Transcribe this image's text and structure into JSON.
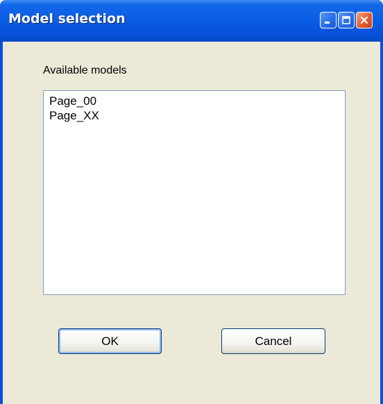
{
  "window": {
    "title": "Model selection"
  },
  "titlebar_buttons": {
    "minimize_icon": "minimize-icon",
    "maximize_icon": "maximize-icon",
    "close_icon": "close-icon"
  },
  "dialog": {
    "list_label": "Available models",
    "models": [
      "Page_00",
      "Page_XX"
    ],
    "ok_label": "OK",
    "cancel_label": "Cancel"
  },
  "colors": {
    "titlebar": "#0a5de3",
    "client_background": "#ece9d8",
    "close_button": "#e35d33",
    "listbox_border": "#7f9db9"
  }
}
